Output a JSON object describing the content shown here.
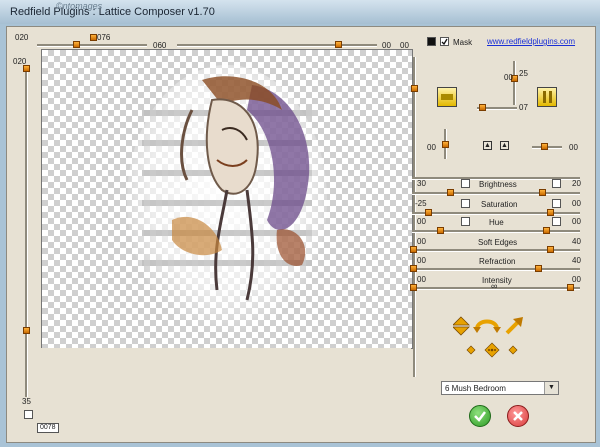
{
  "window": {
    "title": "Redfield Plugins : Lattice Composer v1.70",
    "watermark": "©ntomages"
  },
  "top": {
    "left_num": "020",
    "slider_num": "076",
    "mid_num": "060",
    "right1": "00",
    "right2": "00"
  },
  "left": {
    "top_num": "020",
    "bottom_num": "35"
  },
  "status": {
    "value": "0078"
  },
  "mask": {
    "label": "Mask",
    "checked": true
  },
  "link": {
    "text": "www.redfieldplugins.com"
  },
  "rotation": {
    "val_a": "00",
    "val_b": "25",
    "val_c": "07",
    "val_d": "00",
    "val_e": "00"
  },
  "adjust": [
    {
      "label": "Brightness",
      "left": "30",
      "right": "20"
    },
    {
      "label": "Saturation",
      "left": "-25",
      "right": "00"
    },
    {
      "label": "Hue",
      "left": "00",
      "right": "00"
    },
    {
      "label": "Soft Edges",
      "left": "00",
      "right": "40"
    },
    {
      "label": "Refraction",
      "left": "00",
      "right": "40"
    },
    {
      "label": "Intensity",
      "left": "00",
      "right": "00"
    }
  ],
  "preset": {
    "selected": "6 Mush Bedroom"
  },
  "colors": {
    "accent": "#e8a200",
    "ok": "#2e9b24",
    "cancel": "#d83a3a"
  }
}
